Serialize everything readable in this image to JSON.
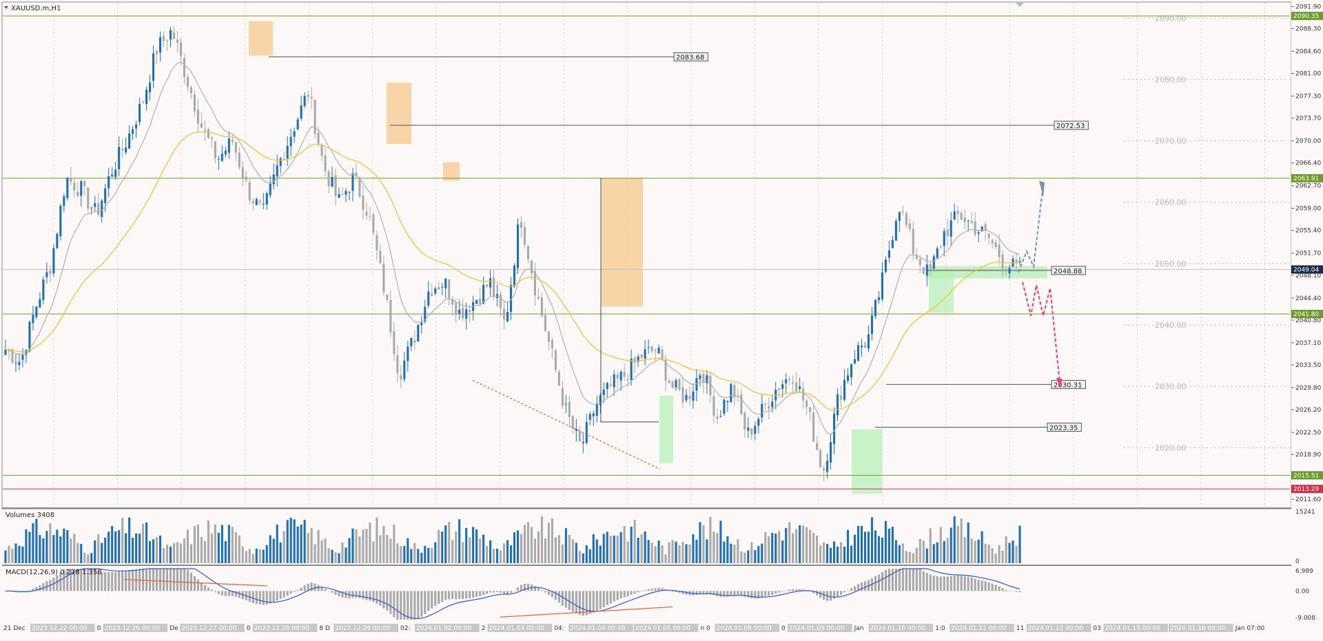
{
  "symbol_label": "XAUUSD.m,H1",
  "volume_label": "Volumes 3408",
  "macd_label": "MACD(12,26,9) 0.218 1.358",
  "colors": {
    "background": "#fcf8f8",
    "bull_candle": "#1f6fb5",
    "bear_candle": "#a9a9a9",
    "ema_fast": "#b0b0b0",
    "ema_slow": "#f0c030",
    "horizontal_level": "#6f9a2e",
    "bid_line": "#c0c0c0",
    "low_line": "#d0304a",
    "macd_signal": "#3355cc",
    "divergence": "#e06030",
    "projection_up": "#7d8fb0",
    "projection_down": "#e6407a",
    "zone_orange": "#f7c98b",
    "zone_green": "#b8f0b8"
  },
  "chart_data": [
    {
      "type": "candlestick",
      "symbol": "XAUUSD.m",
      "timeframe": "H1",
      "ylim": [
        2010.5,
        2092.5
      ],
      "price_axis_ticks": [
        "2091.90",
        "2088.30",
        "2084.60",
        "2081.00",
        "2077.30",
        "2073.70",
        "2070.00",
        "2066.40",
        "2062.70",
        "2059.00",
        "2055.40",
        "2051.70",
        "2048.10",
        "2044.40",
        "2040.80",
        "2037.10",
        "2033.50",
        "2029.80",
        "2026.20",
        "2022.50",
        "2018.90",
        "2015.20",
        "2011.60"
      ],
      "round_levels": [
        "2090.00",
        "2080.00",
        "2070.00",
        "2060.00",
        "2050.00",
        "2040.00",
        "2030.00",
        "2020.00"
      ],
      "horizontal_levels": [
        {
          "price": 2090.35,
          "label": "2090.35"
        },
        {
          "price": 2063.91,
          "label": "2063.91"
        },
        {
          "price": 2041.8,
          "label": "2041.80"
        },
        {
          "price": 2015.51,
          "label": "2015.51"
        }
      ],
      "current_price": {
        "price": 2049.04,
        "label": "2049.04"
      },
      "low_marker": {
        "price": 2013.29,
        "label": "2013.29"
      },
      "annotated_levels": [
        {
          "price": 2083.68,
          "label": "2083.68"
        },
        {
          "price": 2072.53,
          "label": "2072.53"
        },
        {
          "price": 2048.88,
          "label": "2048.88"
        },
        {
          "price": 2030.31,
          "label": "2030.31"
        },
        {
          "price": 2023.35,
          "label": "2023.35"
        }
      ],
      "time_axis_labels": [
        "21 Dec",
        "2023.12.22 00:00",
        "0",
        "2023.12.26 00:00",
        "De",
        "2023.12.27 00:00",
        "0",
        "2023.12.28 00:00",
        "8 D",
        "2023.12.29 00:00",
        "02:",
        "2024.01.02 00:00",
        "2",
        "2024.01.03 00:00",
        "04:",
        "2024.01.04 00:00",
        "2024.01.05 00:00",
        "n 0",
        "2024.01.08 00:00",
        "0",
        "2024.01.09 00:00",
        "Jan",
        "2024.01.10 00:00",
        "1:0",
        "2024.01.11 00:00",
        "11",
        "2024.01.12 00:00",
        "03",
        "2024.01.15 00:00",
        "2024.01.16 00:00",
        "Jan 07:00"
      ],
      "key_prices_path": [
        2036,
        2034,
        2043,
        2050,
        2064,
        2062,
        2058,
        2065,
        2070,
        2076,
        2085,
        2088,
        2080,
        2072,
        2067,
        2070,
        2062,
        2058,
        2066,
        2072,
        2078,
        2066,
        2060,
        2064,
        2058,
        2046,
        2032,
        2038,
        2046,
        2047,
        2042,
        2044,
        2047,
        2040,
        2058,
        2046,
        2036,
        2026,
        2020,
        2027,
        2030,
        2032,
        2035,
        2036,
        2030,
        2028,
        2033,
        2025,
        2030,
        2022,
        2026,
        2030,
        2032,
        2026,
        2016,
        2028,
        2035,
        2038,
        2048,
        2060,
        2052,
        2048,
        2055,
        2058,
        2056,
        2054,
        2050,
        2049
      ]
    },
    {
      "type": "bar",
      "name": "Volumes",
      "ylim": [
        0,
        15241
      ],
      "axis_ticks": [
        "15241",
        "0"
      ]
    },
    {
      "type": "bar",
      "name": "MACD(12,26,9)",
      "ylim": [
        -9.008,
        6.989
      ],
      "axis_ticks": [
        "6.989",
        "0.00",
        "-9.008"
      ]
    }
  ]
}
